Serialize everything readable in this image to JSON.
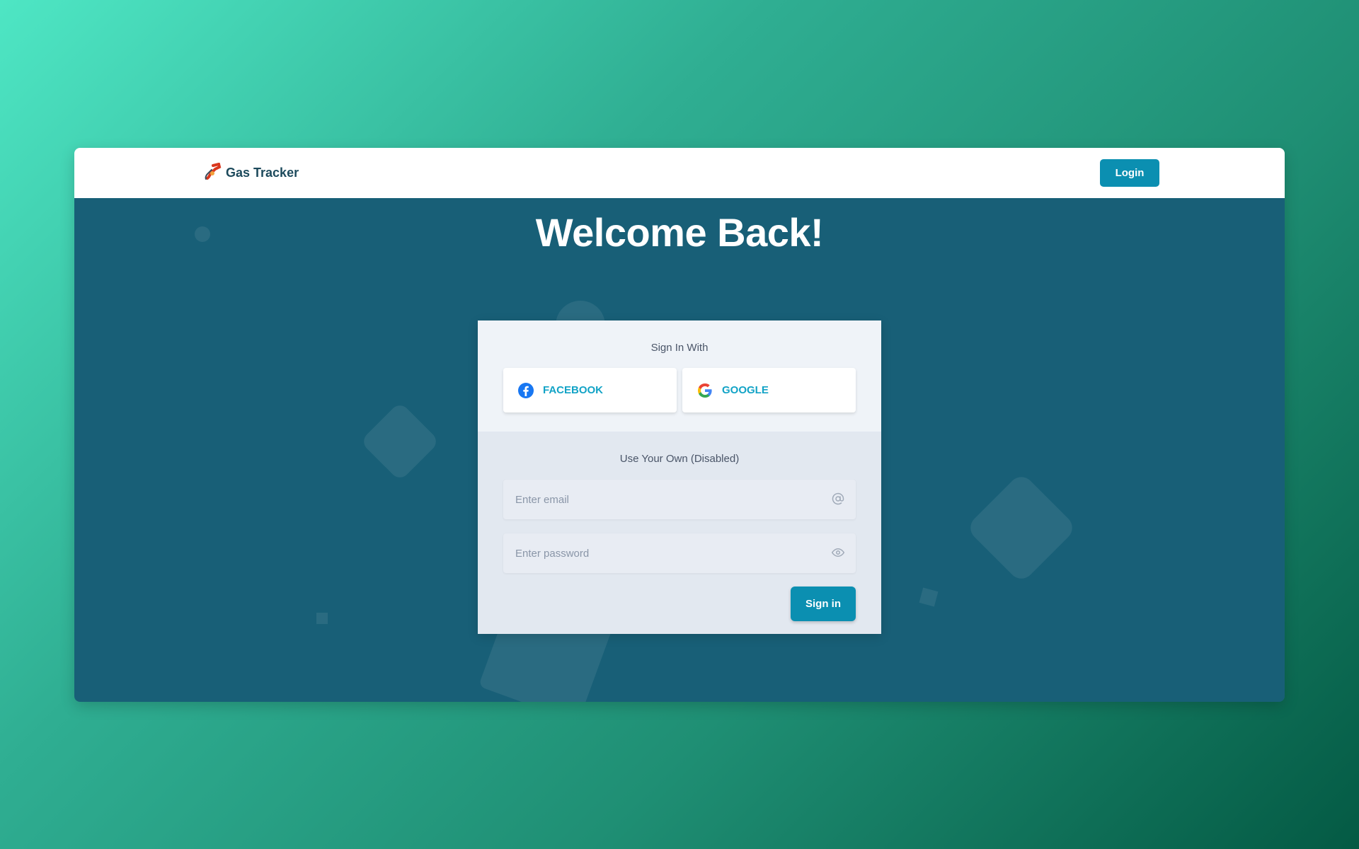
{
  "navbar": {
    "brand_name": "Gas Tracker",
    "brand_icon": "fuel-nozzle-icon",
    "login_label": "Login"
  },
  "hero": {
    "title": "Welcome Back!"
  },
  "social": {
    "heading": "Sign In With",
    "facebook_label": "FACEBOOK",
    "google_label": "GOOGLE"
  },
  "form": {
    "heading": "Use Your Own (Disabled)",
    "email_placeholder": "Enter email",
    "password_placeholder": "Enter password",
    "email_icon": "at-sign-icon",
    "password_icon": "eye-icon",
    "submit_label": "Sign in"
  },
  "colors": {
    "accent": "#0b8fb1",
    "hero_bg": "#185f77",
    "social_text": "#12a3c6",
    "navbar_text": "#1d4a5c"
  }
}
